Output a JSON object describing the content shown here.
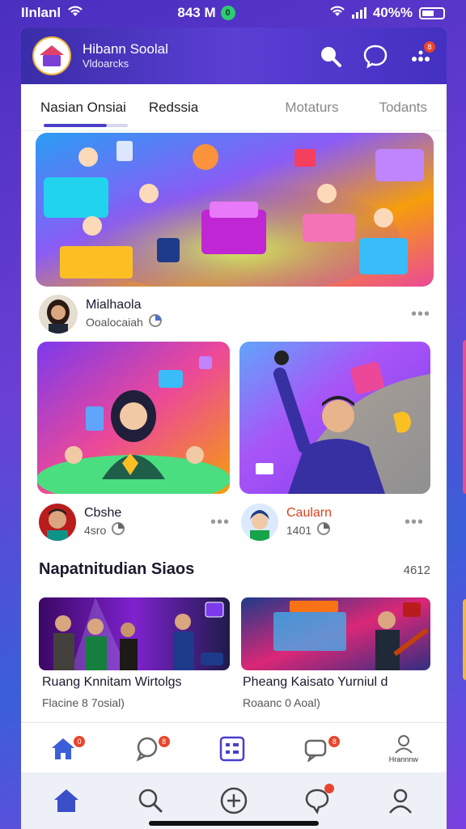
{
  "status_bar": {
    "carrier": "Ilnlanl",
    "time": "843 M",
    "indicator": "0",
    "battery": "40%%"
  },
  "header": {
    "title": "Hibann Soolal",
    "subtitle": "Vldoarcks",
    "message_badge": "",
    "more_badge": "8"
  },
  "tabs": [
    {
      "label": "Nasian Onsiai"
    },
    {
      "label": "Redssia"
    },
    {
      "label": "Motaturs"
    },
    {
      "label": "Todants"
    }
  ],
  "feature_author": {
    "name": "Mialhaola",
    "sub": "Ooalocaiah"
  },
  "cards": [
    {
      "name": "Cbshe",
      "sub": "4sro"
    },
    {
      "name": "Caularn",
      "sub": "1401"
    }
  ],
  "section": {
    "title": "Napatnitudian Siaos",
    "count": "4612"
  },
  "bottom_cards": [
    {
      "title": "Ruang Knnitam Wirtolgs",
      "sub": "Flacine 8 7osial)"
    },
    {
      "title": "Pheang Kaisato Yurniul d",
      "sub": "Roaanc 0 Aoal)"
    }
  ],
  "nav_top": {
    "home_badge": "0",
    "chat_badge": "8",
    "chat2_badge": "8",
    "profile_label": "Hrannnw"
  },
  "colors": {
    "accent": "#4a3fc9",
    "header": "#4330c1",
    "badge": "#e8452c",
    "highlight_name": "#d9421f"
  }
}
